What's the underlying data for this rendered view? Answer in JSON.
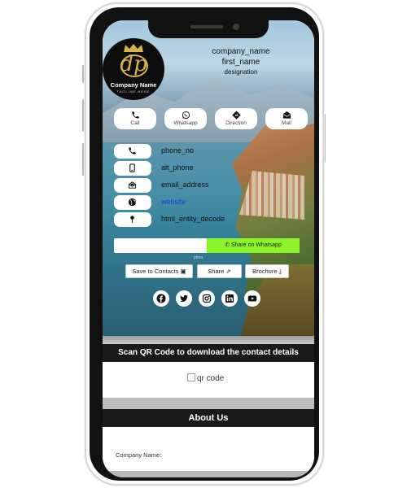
{
  "profile": {
    "logo_name": "Company Name",
    "logo_tagline": "TAGLINE HERE",
    "company_name": "company_name",
    "first_name": "first_name",
    "designation": "designation"
  },
  "actions": [
    {
      "label": "Call",
      "icon": "phone-icon"
    },
    {
      "label": "Whatsapp",
      "icon": "whatsapp-icon"
    },
    {
      "label": "Direction",
      "icon": "direction-icon"
    },
    {
      "label": "Mail",
      "icon": "mail-icon"
    }
  ],
  "contacts": [
    {
      "text": "phone_no",
      "icon": "phone-icon"
    },
    {
      "text": "alt_phone",
      "icon": "mobile-icon"
    },
    {
      "text": "email_address",
      "icon": "envelope-icon"
    },
    {
      "text": "website",
      "icon": "globe-icon"
    },
    {
      "text": "html_entity_decode",
      "icon": "map-pin-icon"
    }
  ],
  "share": {
    "button_label": "Share on Whatsapp",
    "note": "phno"
  },
  "buttons": {
    "save_contacts": "Save to Contacts",
    "share": "Share",
    "brochure": "Brochure"
  },
  "social": [
    "facebook-icon",
    "twitter-icon",
    "instagram-icon",
    "linkedin-icon",
    "youtube-icon"
  ],
  "qr_section": {
    "heading": "Scan QR Code to download the contact details",
    "image_alt": "qr code"
  },
  "about": {
    "heading": "About Us",
    "company_label": "Company Name:"
  },
  "colors": {
    "whatsapp_green": "#8cf52a",
    "bar_dark": "#1a1a1a",
    "link_blue": "#1a3ee0",
    "gold": "#d9b24c"
  }
}
